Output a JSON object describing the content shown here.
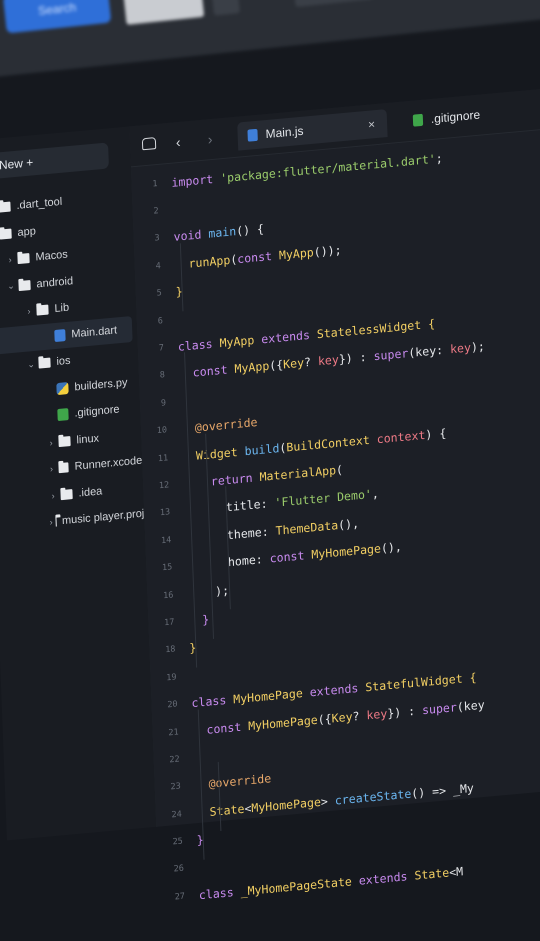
{
  "topbar": {
    "button_label": "Search"
  },
  "sidebar": {
    "new_label": "New  +",
    "items": [
      {
        "label": ".dart_tool",
        "icon": "folder-icon",
        "depth": 0,
        "chevron": ""
      },
      {
        "label": "app",
        "icon": "folder-icon",
        "depth": 0,
        "chevron": ""
      },
      {
        "label": "Macos",
        "icon": "folder-icon",
        "depth": 1,
        "chevron": "›"
      },
      {
        "label": "android",
        "icon": "folder-icon",
        "depth": 1,
        "chevron": "⌄"
      },
      {
        "label": "Lib",
        "icon": "folder-icon",
        "depth": 2,
        "chevron": "›"
      },
      {
        "label": "Main.dart",
        "icon": "dart-file-icon",
        "depth": 3,
        "chevron": "",
        "selected": true
      },
      {
        "label": "ios",
        "icon": "folder-icon",
        "depth": 2,
        "chevron": "⌄"
      },
      {
        "label": "builders.py",
        "icon": "python-file-icon",
        "depth": 3,
        "chevron": ""
      },
      {
        "label": ".gitignore",
        "icon": "git-file-icon",
        "depth": 3,
        "chevron": ""
      },
      {
        "label": "linux",
        "icon": "folder-icon",
        "depth": 3,
        "chevron": "›"
      },
      {
        "label": "Runner.xcode",
        "icon": "folder-icon",
        "depth": 3,
        "chevron": "›"
      },
      {
        "label": ".idea",
        "icon": "folder-icon",
        "depth": 3,
        "chevron": "›"
      },
      {
        "label": "music player.proj",
        "icon": "folder-icon",
        "depth": 3,
        "chevron": "›"
      }
    ]
  },
  "tabs": [
    {
      "label": "Main.js",
      "icon": "js-file-icon",
      "close": "×"
    },
    {
      "label": ".gitignore",
      "icon": "git-file-icon",
      "close": ""
    }
  ],
  "colors": {
    "keyword": "#c98bf0",
    "string": "#9acb6b",
    "type": "#f2cf63",
    "annotation": "#e8a86a",
    "param": "#ee7a86"
  },
  "code_lines": [
    [
      {
        "t": "import ",
        "c": "k"
      },
      {
        "t": "'package:flutter/material.dart'",
        "c": "s"
      },
      {
        "t": ";",
        "c": "p"
      }
    ],
    [],
    [
      {
        "t": "void ",
        "c": "k"
      },
      {
        "t": "main",
        "c": "fn"
      },
      {
        "t": "() {",
        "c": "p"
      }
    ],
    [
      {
        "t": "  runApp",
        "c": "t"
      },
      {
        "t": "(",
        "c": "p"
      },
      {
        "t": "const ",
        "c": "k"
      },
      {
        "t": "MyApp",
        "c": "t"
      },
      {
        "t": "());",
        "c": "p"
      }
    ],
    [
      {
        "t": "}",
        "c": "t"
      }
    ],
    [],
    [
      {
        "t": "class ",
        "c": "k"
      },
      {
        "t": "MyApp ",
        "c": "t"
      },
      {
        "t": "extends ",
        "c": "k"
      },
      {
        "t": "StatelessWidget ",
        "c": "t"
      },
      {
        "t": "{",
        "c": "t"
      }
    ],
    [
      {
        "t": "  const ",
        "c": "k"
      },
      {
        "t": "MyApp",
        "c": "t"
      },
      {
        "t": "({",
        "c": "p"
      },
      {
        "t": "Key",
        "c": "t"
      },
      {
        "t": "? ",
        "c": "p"
      },
      {
        "t": "key",
        "c": "r"
      },
      {
        "t": "}) : ",
        "c": "p"
      },
      {
        "t": "super",
        "c": "k"
      },
      {
        "t": "(key: ",
        "c": "p"
      },
      {
        "t": "key",
        "c": "r"
      },
      {
        "t": ");",
        "c": "p"
      }
    ],
    [],
    [
      {
        "t": "  @override",
        "c": "a"
      }
    ],
    [
      {
        "t": "  Widget ",
        "c": "t"
      },
      {
        "t": "build",
        "c": "fn"
      },
      {
        "t": "(",
        "c": "p"
      },
      {
        "t": "BuildContext ",
        "c": "t"
      },
      {
        "t": "context",
        "c": "r"
      },
      {
        "t": ") {",
        "c": "p"
      }
    ],
    [
      {
        "t": "    return ",
        "c": "k"
      },
      {
        "t": "MaterialApp",
        "c": "t"
      },
      {
        "t": "(",
        "c": "p"
      }
    ],
    [
      {
        "t": "      title: ",
        "c": "p"
      },
      {
        "t": "'Flutter Demo'",
        "c": "s"
      },
      {
        "t": ",",
        "c": "p"
      }
    ],
    [
      {
        "t": "      theme: ",
        "c": "p"
      },
      {
        "t": "ThemeData",
        "c": "t"
      },
      {
        "t": "(),",
        "c": "p"
      }
    ],
    [
      {
        "t": "      home: ",
        "c": "p"
      },
      {
        "t": "const ",
        "c": "k"
      },
      {
        "t": "MyHomePage",
        "c": "t"
      },
      {
        "t": "(),",
        "c": "p"
      }
    ],
    [
      {
        "t": "    );",
        "c": "p"
      }
    ],
    [
      {
        "t": "  }",
        "c": "k"
      }
    ],
    [
      {
        "t": "}",
        "c": "t"
      }
    ],
    [],
    [
      {
        "t": "class ",
        "c": "k"
      },
      {
        "t": "MyHomePage ",
        "c": "t"
      },
      {
        "t": "extends ",
        "c": "k"
      },
      {
        "t": "StatefulWidget ",
        "c": "t"
      },
      {
        "t": "{",
        "c": "t"
      }
    ],
    [
      {
        "t": "  const ",
        "c": "k"
      },
      {
        "t": "MyHomePage",
        "c": "t"
      },
      {
        "t": "({",
        "c": "p"
      },
      {
        "t": "Key",
        "c": "t"
      },
      {
        "t": "? ",
        "c": "p"
      },
      {
        "t": "key",
        "c": "r"
      },
      {
        "t": "}) : ",
        "c": "p"
      },
      {
        "t": "super",
        "c": "k"
      },
      {
        "t": "(key",
        "c": "p"
      }
    ],
    [],
    [
      {
        "t": "  @override",
        "c": "a"
      }
    ],
    [
      {
        "t": "  State",
        "c": "t"
      },
      {
        "t": "<",
        "c": "p"
      },
      {
        "t": "MyHomePage",
        "c": "t"
      },
      {
        "t": "> ",
        "c": "p"
      },
      {
        "t": "createState",
        "c": "fn"
      },
      {
        "t": "() => _My",
        "c": "p"
      }
    ],
    [
      {
        "t": "}",
        "c": "k"
      }
    ],
    [],
    [
      {
        "t": "class ",
        "c": "k"
      },
      {
        "t": "_MyHomePageState ",
        "c": "t"
      },
      {
        "t": "extends ",
        "c": "k"
      },
      {
        "t": "State",
        "c": "t"
      },
      {
        "t": "<M",
        "c": "p"
      }
    ]
  ]
}
